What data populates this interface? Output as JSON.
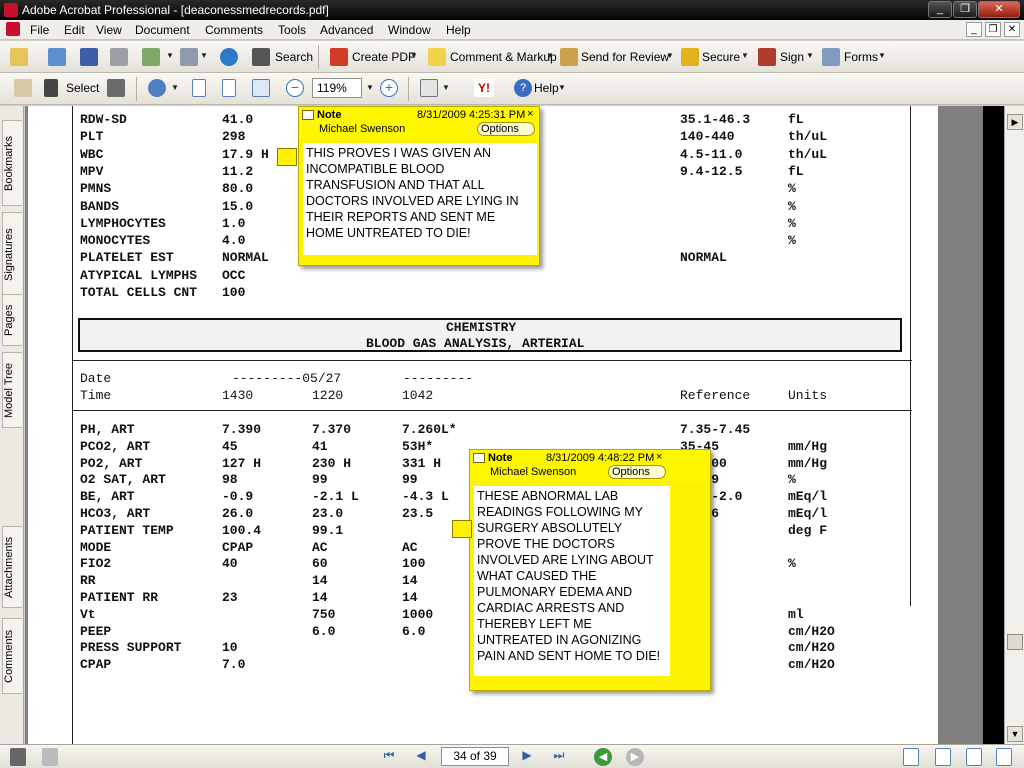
{
  "window": {
    "title": "Adobe Acrobat Professional - [deaconessmedrecords.pdf]",
    "minimize": "_",
    "restore": "❐",
    "close": "✕"
  },
  "menu": [
    "File",
    "Edit",
    "View",
    "Document",
    "Comments",
    "Tools",
    "Advanced",
    "Window",
    "Help"
  ],
  "toolbar1": {
    "search": "Search",
    "create_pdf": "Create PDF",
    "comment_markup": "Comment & Markup",
    "send_review": "Send for Review",
    "secure": "Secure",
    "sign": "Sign",
    "forms": "Forms"
  },
  "toolbar2": {
    "select": "Select",
    "zoom": "119%",
    "help": "Help"
  },
  "nav_tabs": [
    "Bookmarks",
    "Signatures",
    "Pages",
    "Model Tree",
    "Attachments",
    "Comments"
  ],
  "document": {
    "rows_top": [
      [
        "RDW-SD",
        "41.0",
        "",
        "35.1-46.3",
        "fL"
      ],
      [
        "PLT",
        "298",
        "",
        "140-440",
        "th/uL"
      ],
      [
        "WBC",
        "17.9 H",
        "",
        "4.5-11.0",
        "th/uL"
      ],
      [
        "MPV",
        "11.2",
        "",
        "9.4-12.5",
        "fL"
      ],
      [
        "PMNS",
        "80.0",
        "",
        "",
        "%"
      ],
      [
        "BANDS",
        "15.0",
        "",
        "",
        "%"
      ],
      [
        "LYMPHOCYTES",
        "1.0",
        "",
        "",
        "%"
      ],
      [
        "MONOCYTES",
        "4.0",
        "",
        "",
        "%"
      ],
      [
        "PLATELET EST",
        "NORMAL",
        "",
        "NORMAL",
        ""
      ],
      [
        "ATYPICAL LYMPHS",
        "OCC",
        "",
        "",
        ""
      ],
      [
        "TOTAL CELLS CNT",
        "100",
        "",
        "",
        ""
      ]
    ],
    "chem_title1": "CHEMISTRY",
    "chem_title2": "BLOOD GAS ANALYSIS, ARTERIAL",
    "header": {
      "date_label": "Date",
      "time_label": "Time",
      "date_line": "---------05/27",
      "dash2": "---------",
      "t1": "1430",
      "t2": "1220",
      "t3": "1042",
      "ref": "Reference",
      "units": "Units"
    },
    "rows_gas": [
      [
        "PH, ART",
        "7.390",
        "7.370",
        "7.260L*",
        "7.35-7.45",
        ""
      ],
      [
        "PCO2, ART",
        "45",
        "41",
        "53H*",
        "35-45",
        "mm/Hg"
      ],
      [
        "PO2, ART",
        "127 H",
        "230 H",
        "331 H",
        "80-100",
        "mm/Hg"
      ],
      [
        "O2 SAT, ART",
        "98",
        "99",
        "99",
        "95-99",
        "%"
      ],
      [
        "BE, ART",
        "-0.9",
        "-2.1 L",
        "-4.3 L",
        "-2.0-2.0",
        "mEq/l"
      ],
      [
        "HCO3, ART",
        "26.0",
        "23.0",
        "23.5",
        "22-26",
        "mEq/l"
      ],
      [
        "PATIENT TEMP",
        "100.4",
        "99.1",
        "",
        "",
        "deg F"
      ],
      [
        "MODE",
        "CPAP",
        "AC",
        "AC",
        "",
        ""
      ],
      [
        "FIO2",
        "40",
        "60",
        "100",
        "",
        "%"
      ],
      [
        "RR",
        "",
        "14",
        "14",
        "",
        ""
      ],
      [
        "PATIENT RR",
        "23",
        "14",
        "14",
        "",
        ""
      ],
      [
        "Vt",
        "",
        "750",
        "1000",
        "",
        "ml"
      ],
      [
        "PEEP",
        "",
        "6.0",
        "6.0",
        "",
        "cm/H2O"
      ],
      [
        "PRESS SUPPORT",
        "10",
        "",
        "",
        "",
        "cm/H2O"
      ],
      [
        "CPAP",
        "7.0",
        "",
        "",
        "",
        "cm/H2O"
      ]
    ]
  },
  "notes": [
    {
      "title": "Note",
      "date": "8/31/2009 4:25:31 PM",
      "author": "Michael Swenson",
      "options": "Options",
      "close": "×",
      "text": "THIS PROVES I WAS GIVEN AN INCOMPATIBLE BLOOD TRANSFUSION AND THAT ALL DOCTORS INVOLVED ARE LYING IN THEIR REPORTS AND SENT ME HOME UNTREATED TO DIE!"
    },
    {
      "title": "Note",
      "date": "8/31/2009 4:48:22 PM",
      "author": "Michael Swenson",
      "options": "Options",
      "close": "×",
      "text": "THESE ABNORMAL LAB READINGS FOLLOWING MY SURGERY ABSOLUTELY PROVE THE DOCTORS INVOLVED ARE LYING ABOUT WHAT CAUSED THE PULMONARY EDEMA AND CARDIAC ARRESTS AND THEREBY LEFT ME UNTREATED IN AGONIZING PAIN AND SENT HOME TO DIE!"
    }
  ],
  "status": {
    "page": "34 of 39"
  },
  "colors": {
    "note": "#fff200",
    "note_border": "#b8a800",
    "titlebar": "#050505",
    "page": "#ffffff",
    "doc_bg": "#808080"
  }
}
